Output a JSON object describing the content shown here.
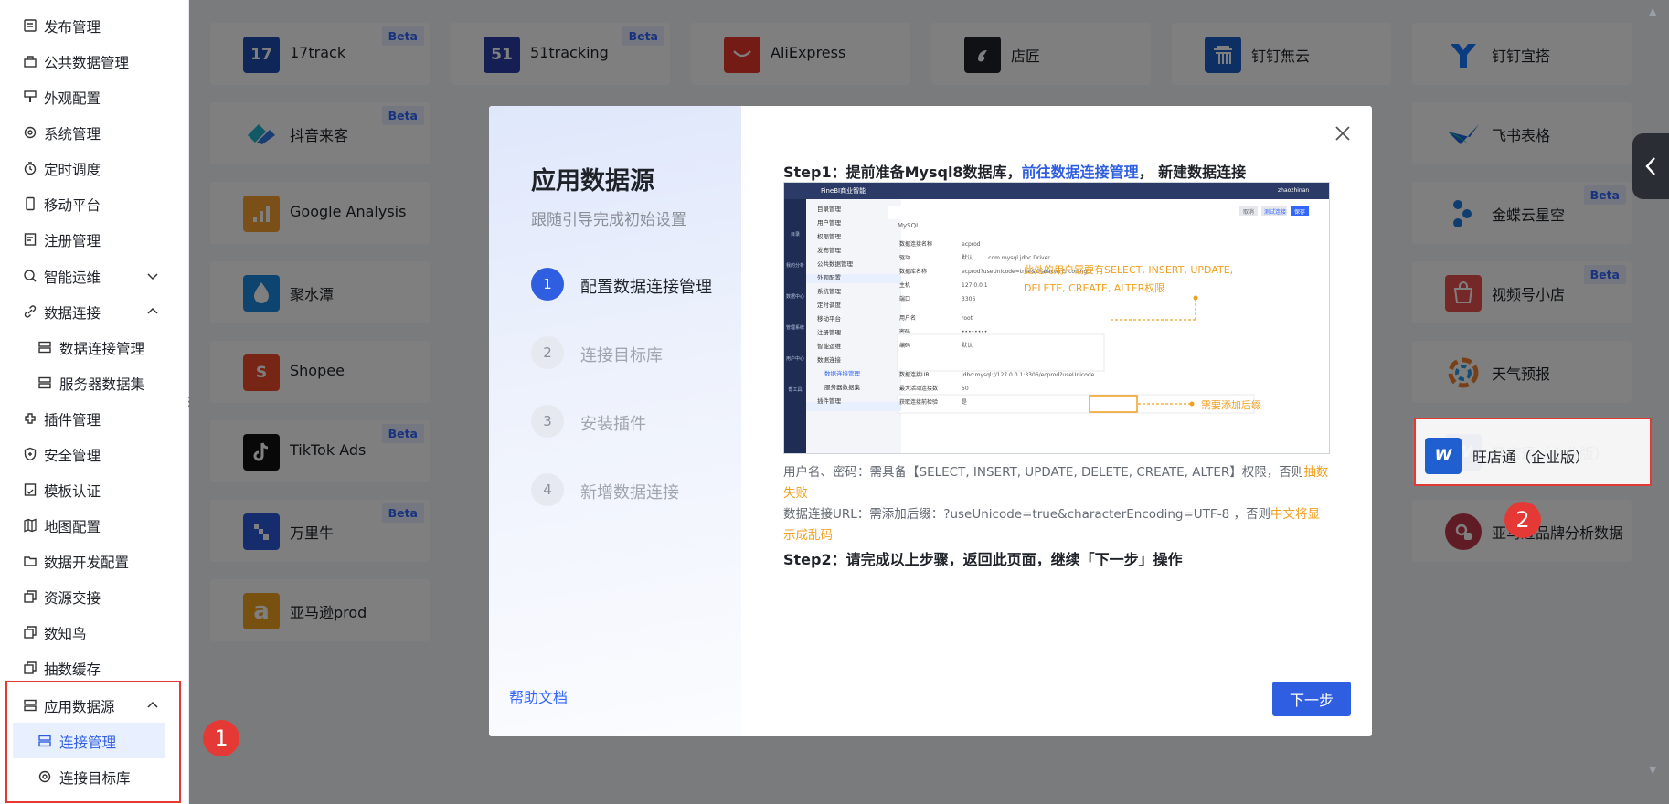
{
  "sidebar": {
    "items": [
      {
        "label": "发布管理",
        "icon": "publish-icon"
      },
      {
        "label": "公共数据管理",
        "icon": "public-data-icon"
      },
      {
        "label": "外观配置",
        "icon": "appearance-icon"
      },
      {
        "label": "系统管理",
        "icon": "gear-icon"
      },
      {
        "label": "定时调度",
        "icon": "timer-icon"
      },
      {
        "label": "移动平台",
        "icon": "mobile-icon"
      },
      {
        "label": "注册管理",
        "icon": "register-icon"
      },
      {
        "label": "智能运维",
        "icon": "ops-icon"
      },
      {
        "label": "数据连接",
        "icon": "link-icon"
      },
      {
        "label": "数据连接管理",
        "icon": "connection-icon"
      },
      {
        "label": "服务器数据集",
        "icon": "dataset-icon"
      },
      {
        "label": "插件管理",
        "icon": "plugin-icon"
      },
      {
        "label": "安全管理",
        "icon": "shield-icon"
      },
      {
        "label": "模板认证",
        "icon": "template-icon"
      },
      {
        "label": "地图配置",
        "icon": "map-icon"
      },
      {
        "label": "数据开发配置",
        "icon": "dev-icon"
      },
      {
        "label": "资源交接",
        "icon": "handover-icon"
      },
      {
        "label": "数知鸟",
        "icon": "bird-icon"
      },
      {
        "label": "抽数缓存",
        "icon": "cache-icon"
      },
      {
        "label": "应用数据源",
        "icon": "app-source-icon"
      },
      {
        "label": "连接管理",
        "icon": "connection-icon"
      },
      {
        "label": "连接目标库",
        "icon": "gear-icon"
      }
    ]
  },
  "cards": {
    "beta_label": "Beta",
    "items": [
      {
        "name": "17track",
        "logo": "17",
        "color": "#1c4fb0"
      },
      {
        "name": "51tracking",
        "logo": "51",
        "color": "#2a3ea8"
      },
      {
        "name": "AliExpress",
        "logo": "",
        "color": "#e8372c"
      },
      {
        "name": "店匠",
        "logo": "",
        "color": "#1f2329"
      },
      {
        "name": "钉钉無云",
        "logo": "",
        "color": "#1a5ec8"
      },
      {
        "name": "钉钉宜搭",
        "logo": "",
        "color": "#1678ff"
      },
      {
        "name": "抖音来客",
        "logo": "",
        "color": "#3aa0e0"
      },
      {
        "name": "飞书表格",
        "logo": "",
        "color": "#1dbf8c"
      },
      {
        "name": "Google Analysis",
        "logo": "",
        "color": "#f4a030"
      },
      {
        "name": "金蝶云星空",
        "logo": "",
        "color": "#1e7be0"
      },
      {
        "name": "聚水潭",
        "logo": "",
        "color": "#1d88e0"
      },
      {
        "name": "视频号小店",
        "logo": "",
        "color": "#e85050"
      },
      {
        "name": "Shopee",
        "logo": "S",
        "color": "#ee4d2d"
      },
      {
        "name": "天气预报",
        "logo": "",
        "color": "#f08030"
      },
      {
        "name": "TikTok Ads",
        "logo": "",
        "color": "#111111"
      },
      {
        "name": "旺店通（企业版）",
        "logo": "W",
        "color": "#1f5fd0"
      },
      {
        "name": "万里牛",
        "logo": "",
        "color": "#2a5bd8"
      },
      {
        "name": "亚马逊品牌分析数据",
        "logo": "",
        "color": "#c0394a"
      },
      {
        "name": "亚马逊prod",
        "logo": "a",
        "color": "#f0a020"
      }
    ]
  },
  "modal": {
    "title": "应用数据源",
    "subtitle": "跟随引导完成初始设置",
    "steps": [
      {
        "num": "1",
        "label": "配置数据连接管理"
      },
      {
        "num": "2",
        "label": "连接目标库"
      },
      {
        "num": "3",
        "label": "安装插件"
      },
      {
        "num": "4",
        "label": "新增数据连接"
      }
    ],
    "step1_prefix": "Step1：提前准备Mysql8数据库，",
    "step1_link": "前往数据连接管理",
    "step1_suffix": "，  新建数据连接",
    "desc_line1_a": "用户名、密码：需具备【SELECT, INSERT, UPDATE, DELETE, CREATE, ALTER】权限，否则",
    "desc_line1_warn": "抽数失败",
    "desc_line2_a": "数据连接URL：需添加后缀：?useUnicode=true&characterEncoding=UTF-8 ，否则",
    "desc_line2_warn": "中文将显示成乱码",
    "step2": "Step2：请完成以上步骤，返回此页面，继续「下一步」操作",
    "help_link": "帮助文档",
    "next_button": "下一步",
    "screenshot": {
      "app_title": "FineBI商业智能",
      "section": "MySQL",
      "menu": [
        "目录管理",
        "用户管理",
        "权限管理",
        "发布管理",
        "公共数据管理",
        "外观配置",
        "系统管理",
        "定时调度",
        "移动平台",
        "注册管理",
        "智能运维",
        "数据连接",
        "数据连接管理",
        "服务器数据集",
        "插件管理"
      ],
      "rail": [
        "目录",
        "我的分析",
        "数据中心",
        "管理系统",
        "用户中心",
        "帮工具"
      ],
      "fields": [
        {
          "label": "数据连接名称",
          "value": "ecprod"
        },
        {
          "label": "驱动",
          "value": "默认"
        },
        {
          "label": "数据库名称",
          "value": "ecprod?useUnicode=true&characterEncoding..."
        },
        {
          "label": "主机",
          "value": "127.0.0.1"
        },
        {
          "label": "端口",
          "value": "3306"
        },
        {
          "label": "用户名",
          "value": "root"
        },
        {
          "label": "密码",
          "value": "••••••••"
        },
        {
          "label": "编码",
          "value": "默认"
        },
        {
          "label": "数据连接URL",
          "value": "jdbc:mysql://127.0.0.1:3306/ecprod?useUnicode..."
        },
        {
          "label": "最大活动连接数",
          "value": "50"
        },
        {
          "label": "获取连接前检验",
          "value": "是"
        }
      ],
      "driver_value": "com.mysql.jdbc.Driver",
      "note_privileges": "此处的用户需要有SELECT, INSERT, UPDATE, DELETE, CREATE, ALTER权限",
      "note_suffix": "需要添加后缀",
      "btn_cancel": "取消",
      "btn_test": "测试连接",
      "btn_save": "保存",
      "user_name": "zhaozhinan"
    }
  },
  "annotations": {
    "badge1": "1",
    "badge2": "2"
  }
}
